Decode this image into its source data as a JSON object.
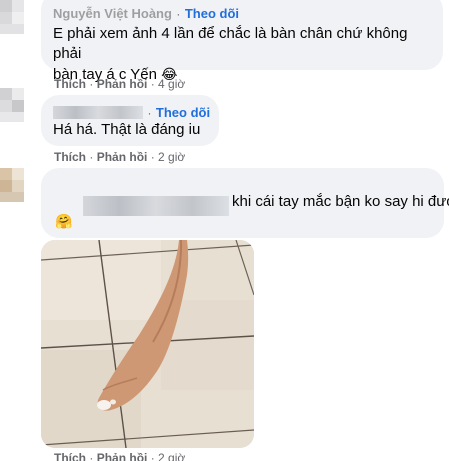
{
  "comments": [
    {
      "author": "Nguyễn Việt Hoàng",
      "follow_label": "Theo dõi",
      "separator": "·",
      "text_line1": "E phải xem ảnh 4 lần để chắc là bàn chân chứ không phải",
      "text_line2": "bàn tay á c Yến",
      "emoji": "😂",
      "like_label": "Thích",
      "reply_label": "Phản hồi",
      "time": "4 giờ"
    },
    {
      "follow_label": "Theo dõi",
      "separator": "·",
      "text": "Há há. Thật là đáng iu",
      "like_label": "Thích",
      "reply_label": "Phản hồi",
      "time": "2 giờ"
    },
    {
      "text": "khi cái tay mắc bận ko say hi được",
      "emoji": "🤗",
      "like_label": "Thích",
      "reply_label": "Phản hồi",
      "time": "2 giờ"
    }
  ],
  "icons": [
    "avatar",
    "hugging-face-emoji",
    "laughing-emoji"
  ],
  "colors": {
    "bubble": "#f0f2f5",
    "link_blue": "#216fdb",
    "secondary_text": "#65676b",
    "floor_tile": "#e9e1d6",
    "skin": "#cf9874"
  }
}
